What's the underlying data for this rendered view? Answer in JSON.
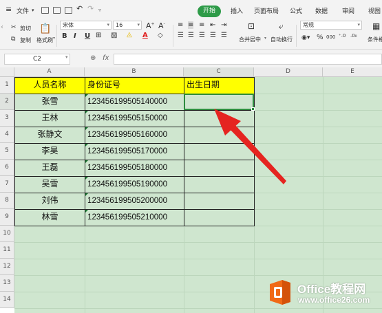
{
  "titlebar": {
    "file_menu": "文件",
    "tabs": [
      "开始",
      "插入",
      "页面布局",
      "公式",
      "数据",
      "审阅",
      "视图"
    ],
    "active_tab": "开始"
  },
  "ribbon": {
    "cut": "剪切",
    "copy": "复制",
    "format_painter": "格式刷",
    "paste": "粘贴",
    "font_name": "宋体",
    "font_size": "16",
    "merge_center": "合并居中",
    "wrap_text": "自动换行",
    "number_format": "常规",
    "conditional_format": "条件格",
    "bold": "B",
    "italic": "I",
    "underline": "U",
    "percent": "%",
    "thousands": "000"
  },
  "formula_bar": {
    "name_box": "C2",
    "fx": "fx",
    "value": ""
  },
  "sheet": {
    "columns": [
      "A",
      "B",
      "C",
      "D",
      "E"
    ],
    "rows": [
      "1",
      "2",
      "3",
      "4",
      "5",
      "6",
      "7",
      "8",
      "9",
      "10",
      "11",
      "12",
      "13",
      "14"
    ],
    "headers": [
      "人员名称",
      "身份证号",
      "出生日期"
    ],
    "data": [
      {
        "name": "张雪",
        "id": "123456199505140000",
        "birth": ""
      },
      {
        "name": "王林",
        "id": "123456199505150000",
        "birth": ""
      },
      {
        "name": "张静文",
        "id": "123456199505160000",
        "birth": ""
      },
      {
        "name": "李昊",
        "id": "123456199505170000",
        "birth": ""
      },
      {
        "name": "王磊",
        "id": "123456199505180000",
        "birth": ""
      },
      {
        "name": "吴雪",
        "id": "123456199505190000",
        "birth": ""
      },
      {
        "name": "刘伟",
        "id": "123456199505200000",
        "birth": ""
      },
      {
        "name": "林雪",
        "id": "123456199505210000",
        "birth": ""
      }
    ],
    "selected_cell": "C2"
  },
  "watermark": {
    "brand": "Office教程网",
    "url": "www.office26.com"
  },
  "colors": {
    "accent_green": "#2e9b48",
    "sheet_bg": "#cfe6cf",
    "header_fill": "#ffff00",
    "arrow_red": "#e52420",
    "logo_orange": "#f06a16"
  }
}
